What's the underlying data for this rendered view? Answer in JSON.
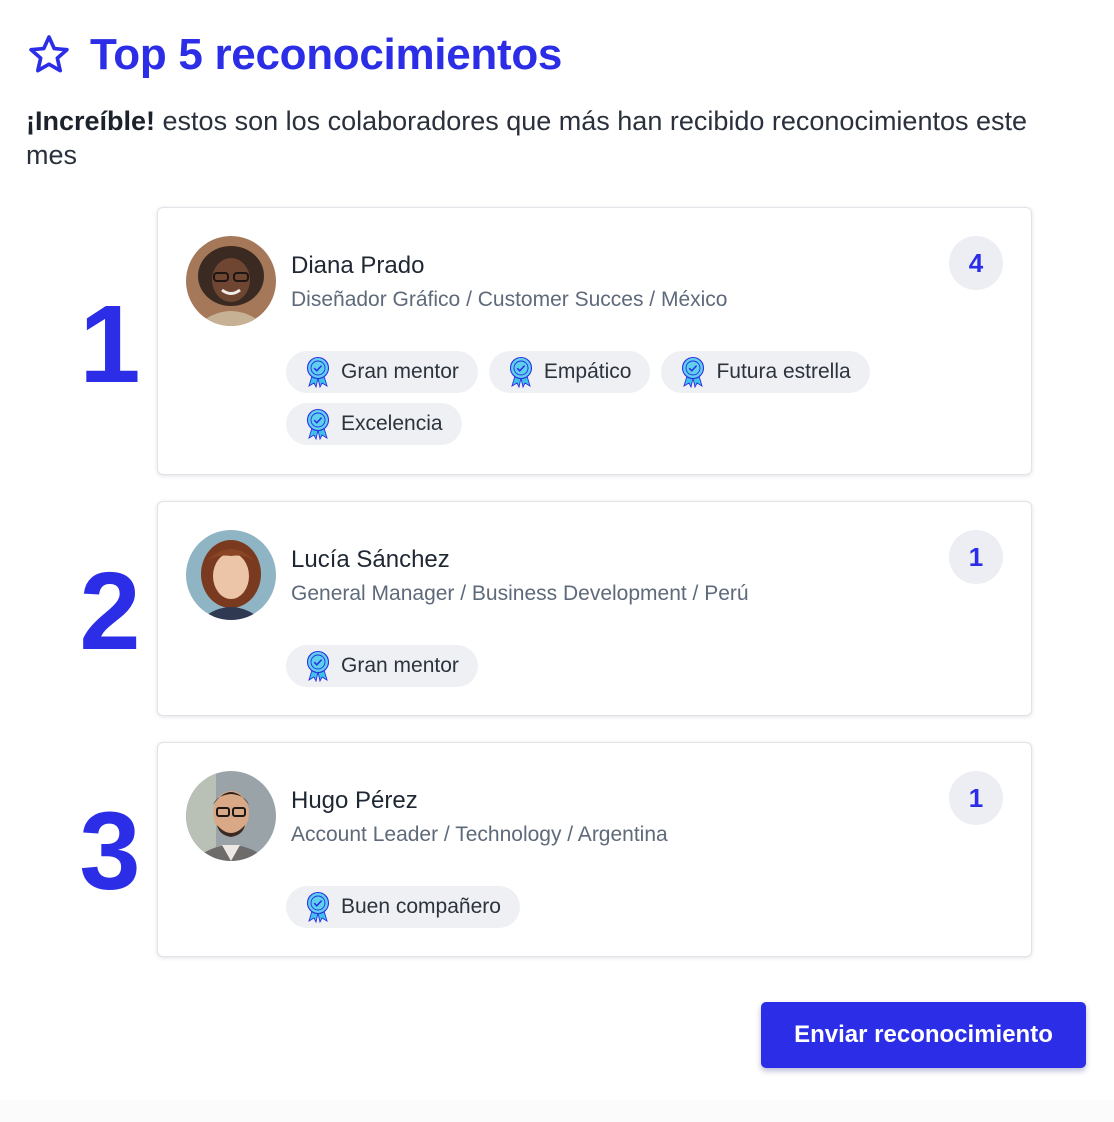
{
  "header": {
    "icon": "star-outline-icon",
    "title": "Top 5 reconocimientos",
    "subtitle_bold": "¡Increíble!",
    "subtitle_rest": " estos son los colaboradores que más han recibido reconocimientos este mes"
  },
  "ranking": [
    {
      "rank": "1",
      "name": "Diana Prado",
      "role": "Diseñador Gráfico / Customer Succes / México",
      "count": "4",
      "badges": [
        "Gran mentor",
        "Empático",
        "Futura estrella",
        "Excelencia"
      ]
    },
    {
      "rank": "2",
      "name": "Lucía Sánchez",
      "role": "General Manager / Business Development / Perú",
      "count": "1",
      "badges": [
        "Gran mentor"
      ]
    },
    {
      "rank": "3",
      "name": "Hugo Pérez",
      "role": "Account Leader / Technology / Argentina",
      "count": "1",
      "badges": [
        "Buen compañero"
      ]
    }
  ],
  "actions": {
    "send_label": "Enviar reconocimiento"
  },
  "colors": {
    "accent": "#2b2ee6",
    "badge_bg": "#eef0f4",
    "medal": "#3ec3e6"
  }
}
